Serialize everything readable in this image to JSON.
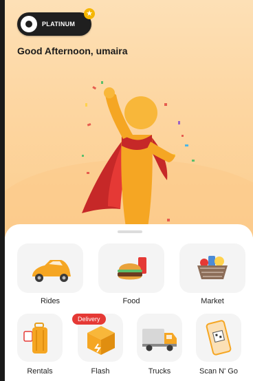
{
  "header": {
    "tier_badge": "PLATINUM",
    "greeting": "Good Afternoon, umaira"
  },
  "services_row1": [
    {
      "label": "Rides",
      "icon": "car-icon"
    },
    {
      "label": "Food",
      "icon": "burger-icon"
    },
    {
      "label": "Market",
      "icon": "basket-icon"
    }
  ],
  "services_row2": [
    {
      "label": "Rentals",
      "icon": "luggage-icon"
    },
    {
      "label": "Flash",
      "icon": "package-icon",
      "tag": "Delivery"
    },
    {
      "label": "Trucks",
      "icon": "truck-icon"
    },
    {
      "label": "Scan N' Go",
      "icon": "qr-phone-icon"
    }
  ],
  "colors": {
    "hero_bg": "#fdd6a1",
    "tag_red": "#e53935",
    "accent_orange": "#f5a623"
  }
}
